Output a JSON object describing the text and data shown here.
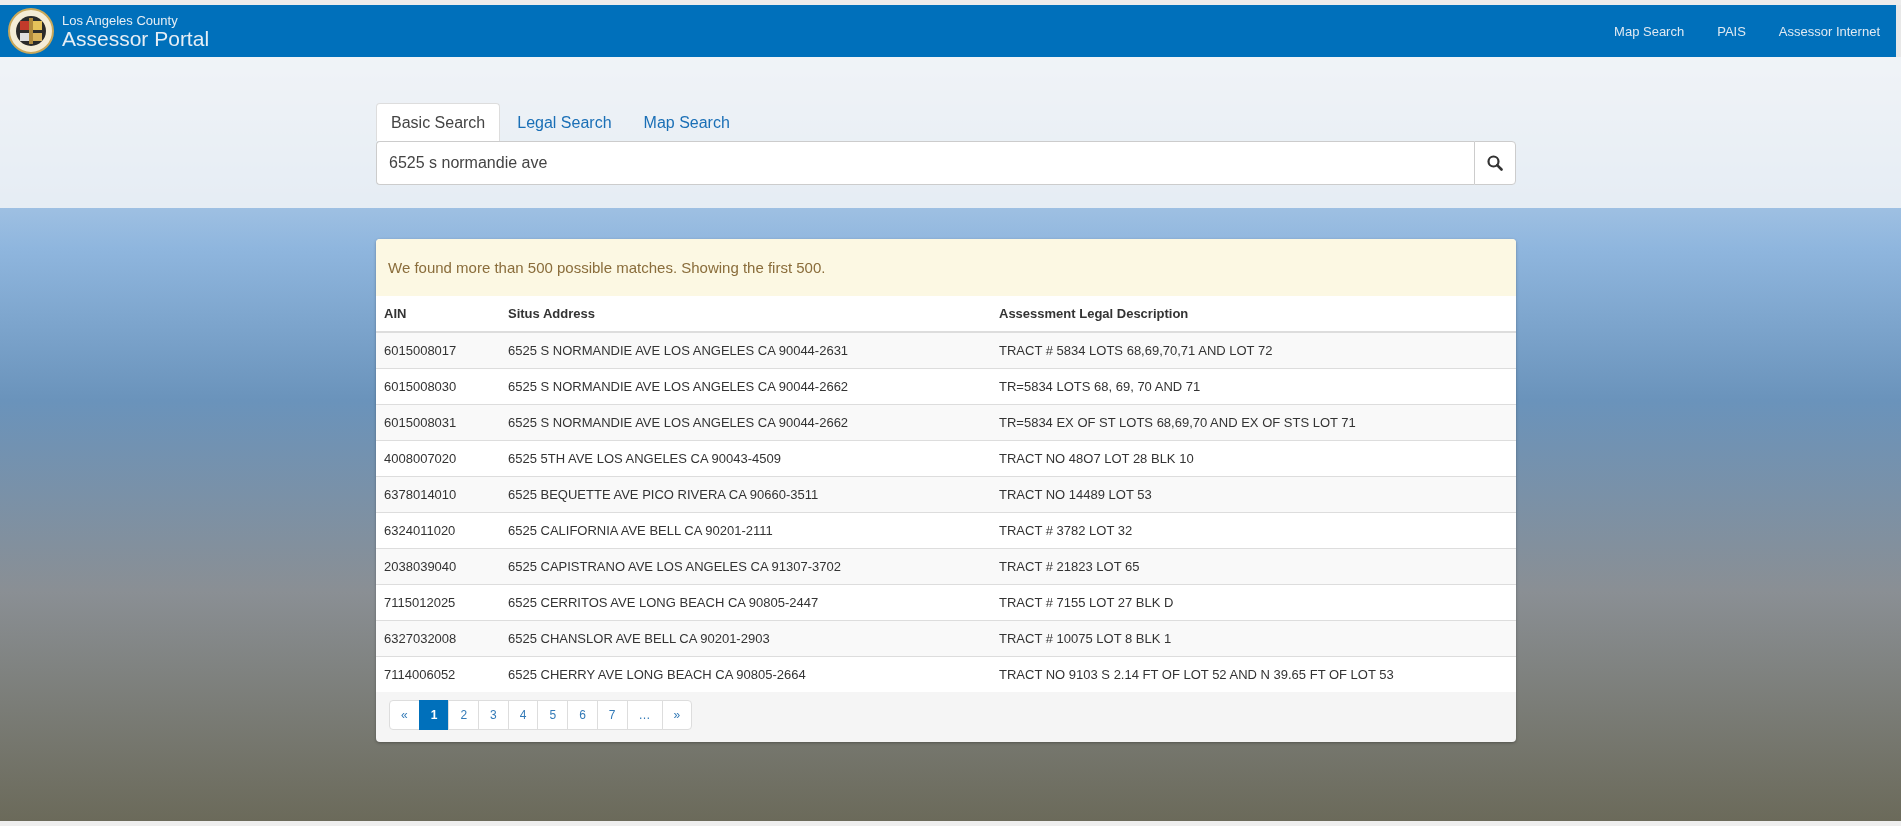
{
  "header": {
    "subtitle": "Los Angeles County",
    "title": "Assessor Portal",
    "nav": [
      "Map Search",
      "PAIS",
      "Assessor Internet"
    ]
  },
  "tabs": [
    {
      "label": "Basic Search",
      "selected": true
    },
    {
      "label": "Legal Search",
      "selected": false
    },
    {
      "label": "Map Search",
      "selected": false
    }
  ],
  "search": {
    "value": "6525 s normandie ave"
  },
  "results": {
    "message": "We found more than 500 possible matches. Showing the first 500.",
    "columns": [
      "AIN",
      "Situs Address",
      "Assessment Legal Description"
    ],
    "rows": [
      [
        "6015008017",
        "6525 S NORMANDIE AVE LOS ANGELES CA 90044-2631",
        "TRACT # 5834 LOTS 68,69,70,71 AND LOT 72"
      ],
      [
        "6015008030",
        "6525 S NORMANDIE AVE LOS ANGELES CA 90044-2662",
        "TR=5834 LOTS 68, 69, 70 AND 71"
      ],
      [
        "6015008031",
        "6525 S NORMANDIE AVE LOS ANGELES CA 90044-2662",
        "TR=5834 EX OF ST LOTS 68,69,70 AND EX OF STS LOT 71"
      ],
      [
        "4008007020",
        "6525 5TH AVE LOS ANGELES CA 90043-4509",
        "TRACT NO 48O7 LOT 28 BLK 10"
      ],
      [
        "6378014010",
        "6525 BEQUETTE AVE PICO RIVERA CA 90660-3511",
        "TRACT NO 14489 LOT 53"
      ],
      [
        "6324011020",
        "6525 CALIFORNIA AVE BELL CA 90201-2111",
        "TRACT # 3782 LOT 32"
      ],
      [
        "2038039040",
        "6525 CAPISTRANO AVE LOS ANGELES CA 91307-3702",
        "TRACT # 21823 LOT 65"
      ],
      [
        "7115012025",
        "6525 CERRITOS AVE LONG BEACH CA 90805-2447",
        "TRACT # 7155 LOT 27 BLK D"
      ],
      [
        "6327032008",
        "6525 CHANSLOR AVE BELL CA 90201-2903",
        "TRACT # 10075 LOT 8 BLK 1"
      ],
      [
        "7114006052",
        "6525 CHERRY AVE LONG BEACH CA 90805-2664",
        "TRACT NO 9103 S 2.14 FT OF LOT 52 AND N 39.65 FT OF LOT 53"
      ]
    ]
  },
  "pagination": [
    {
      "label": "«",
      "selected": false
    },
    {
      "label": "1",
      "selected": true
    },
    {
      "label": "2",
      "selected": false
    },
    {
      "label": "3",
      "selected": false
    },
    {
      "label": "4",
      "selected": false
    },
    {
      "label": "5",
      "selected": false
    },
    {
      "label": "6",
      "selected": false
    },
    {
      "label": "7",
      "selected": false
    },
    {
      "label": "…",
      "selected": false
    },
    {
      "label": "»",
      "selected": false
    }
  ]
}
